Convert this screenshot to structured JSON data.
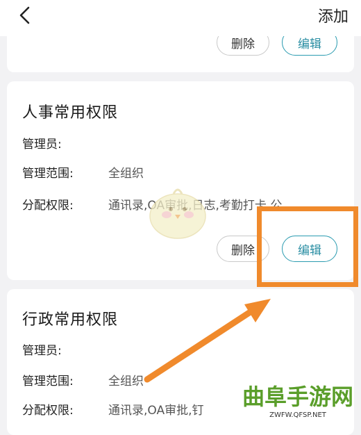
{
  "header": {
    "add_label": "添加"
  },
  "top_card": {
    "delete_label": "删除",
    "edit_label": "编辑"
  },
  "roles": [
    {
      "title": "人事常用权限",
      "admin_label": "管理员:",
      "scope_label": "管理范围:",
      "scope_value": "全组织",
      "perm_label": "分配权限:",
      "perm_value": "通讯录,OA审批,日志,考勤打卡,公…",
      "delete_label": "删除",
      "edit_label": "编辑"
    },
    {
      "title": "行政常用权限",
      "admin_label": "管理员:",
      "scope_label": "管理范围:",
      "scope_value": "全组织",
      "perm_label": "分配权限:",
      "perm_value": "通讯录,OA审批,钉"
    }
  ],
  "watermark": {
    "text": "曲阜手游网",
    "url": "ZWFW.QFSP.NET"
  },
  "colors": {
    "accent": "#2a9bb0",
    "highlight": "#f08a2c",
    "background": "#f2f2f4"
  },
  "icons": {
    "back": "chevron-left-icon"
  }
}
